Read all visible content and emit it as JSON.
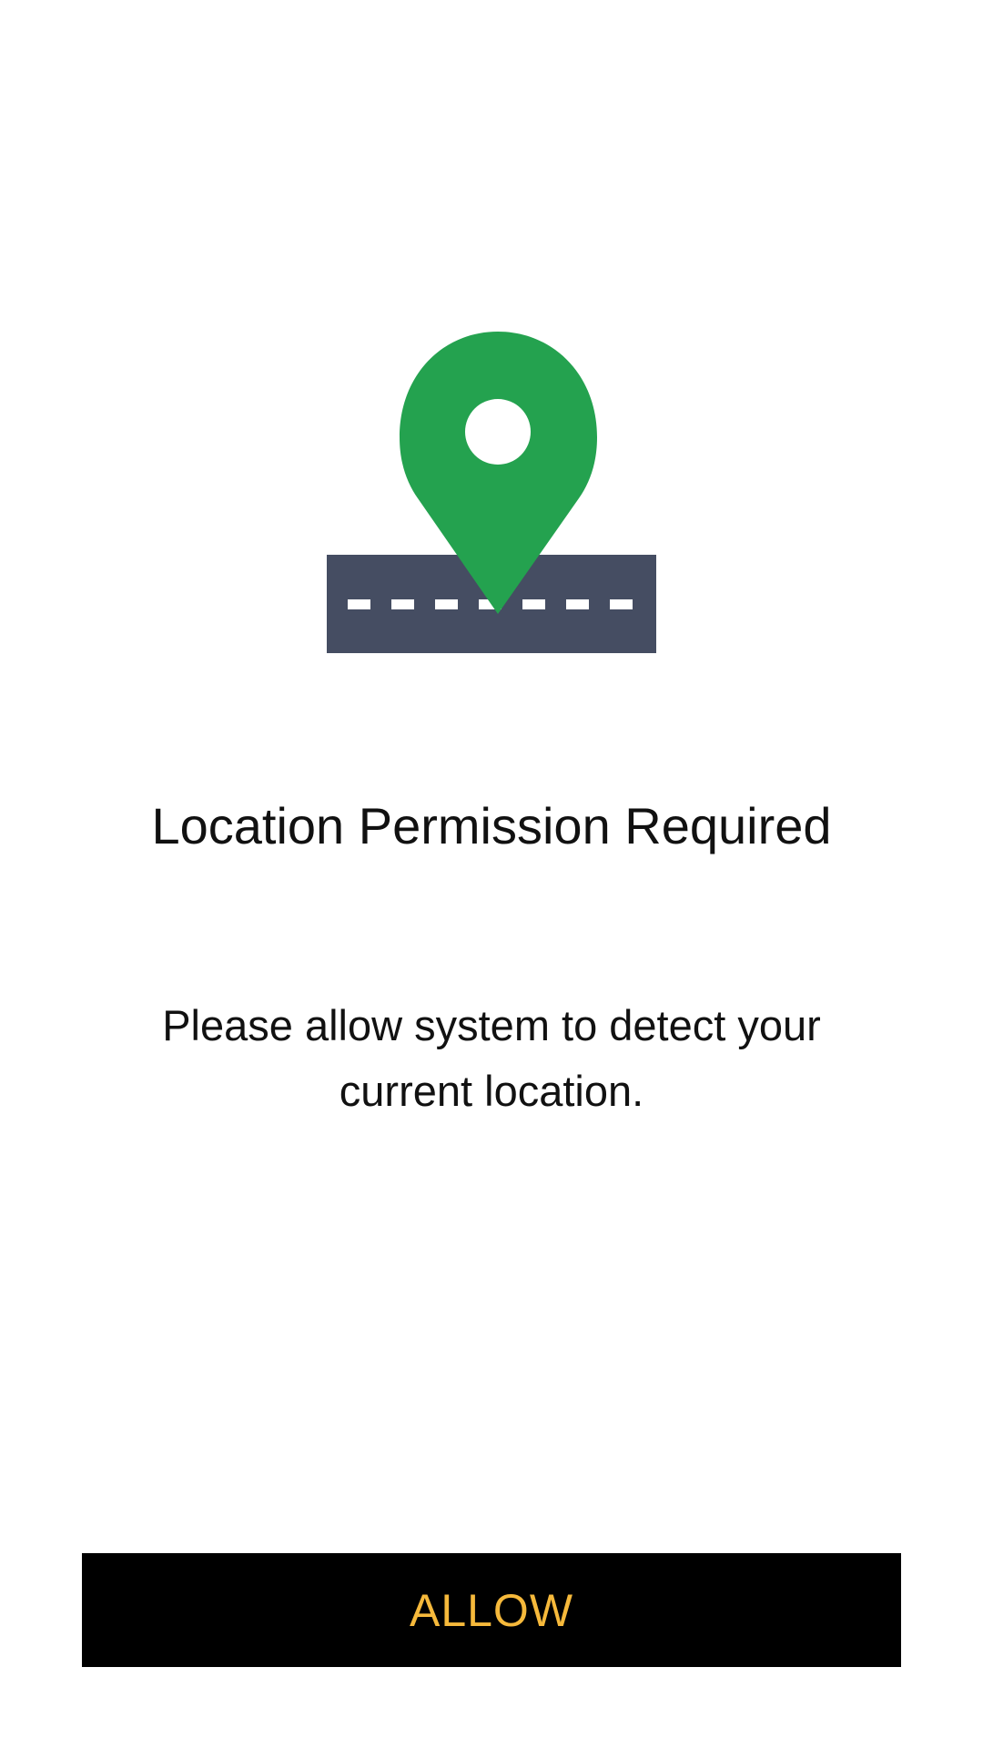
{
  "illustration": {
    "icon": "location-pin-on-road-icon",
    "pin_color": "#24A24F",
    "road_color": "#454D62",
    "road_marking_color": "#FFFFFF"
  },
  "permission": {
    "title": "Location Permission Required",
    "message": "Please allow system to detect your current location."
  },
  "allow_button": {
    "label": "ALLOW",
    "background": "#000000",
    "text_color": "#F6B93B"
  }
}
